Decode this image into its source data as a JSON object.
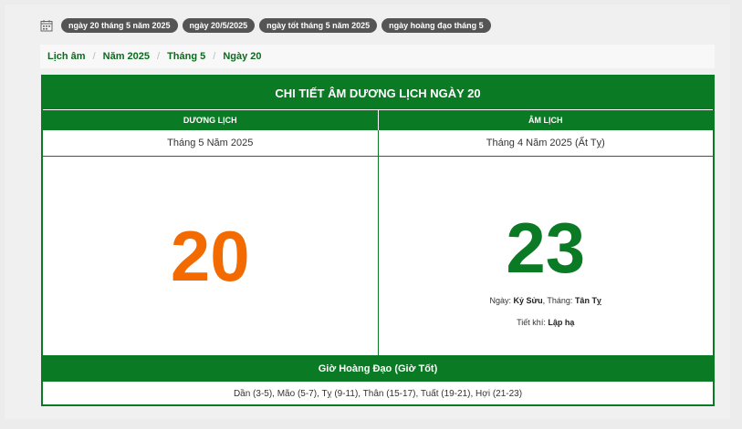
{
  "tags": [
    "ngày 20 tháng 5 năm 2025",
    "ngày 20/5/2025",
    "ngày tốt tháng 5 năm 2025",
    "ngày hoàng đạo tháng 5"
  ],
  "breadcrumb": [
    "Lịch âm",
    "Năm 2025",
    "Tháng 5",
    "Ngày 20"
  ],
  "table": {
    "title": "CHI TIẾT ÂM DƯƠNG LỊCH NGÀY 20",
    "solar_header": "DƯƠNG LỊCH",
    "lunar_header": "ÂM LỊCH",
    "solar_month": "Tháng 5 Năm 2025",
    "lunar_month": "Tháng 4 Năm 2025 (Ất Tỵ)",
    "solar_day": "20",
    "lunar_day": "23",
    "day_label": "Ngày: ",
    "day_value": "Kỷ Sửu",
    "month_label": ", Tháng: ",
    "month_value": "Tân Tỵ",
    "term_label": "Tiết khí: ",
    "term_value": "Lập hạ",
    "hours_title": "Giờ Hoàng Đạo (Giờ Tốt)",
    "hours_value": "Dần (3-5), Mão (5-7), Tỵ (9-11), Thân (15-17), Tuất (19-21), Hợi (21-23)"
  },
  "colors": {
    "primary_green": "#0b7a24",
    "solar_orange": "#f26a00",
    "tag_gray": "#555555"
  }
}
